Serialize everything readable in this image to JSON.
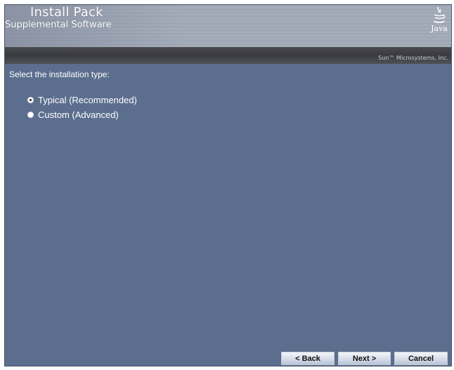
{
  "header": {
    "title": "Install Pack",
    "subtitle": "Supplemental Software",
    "logo_text": "Java",
    "company": "Sun™ Microsystems, Inc."
  },
  "main": {
    "prompt": "Select the installation type:",
    "options": [
      {
        "label": "Typical (Recommended)",
        "selected": true
      },
      {
        "label": "Custom (Advanced)",
        "selected": false
      }
    ]
  },
  "buttons": {
    "back": "< Back",
    "next": "Next >",
    "cancel": "Cancel"
  },
  "icons": {
    "logo": "java-coffee-cup-icon"
  },
  "colors": {
    "background": "#5b6e8d",
    "company_bar": "#3f4045"
  }
}
